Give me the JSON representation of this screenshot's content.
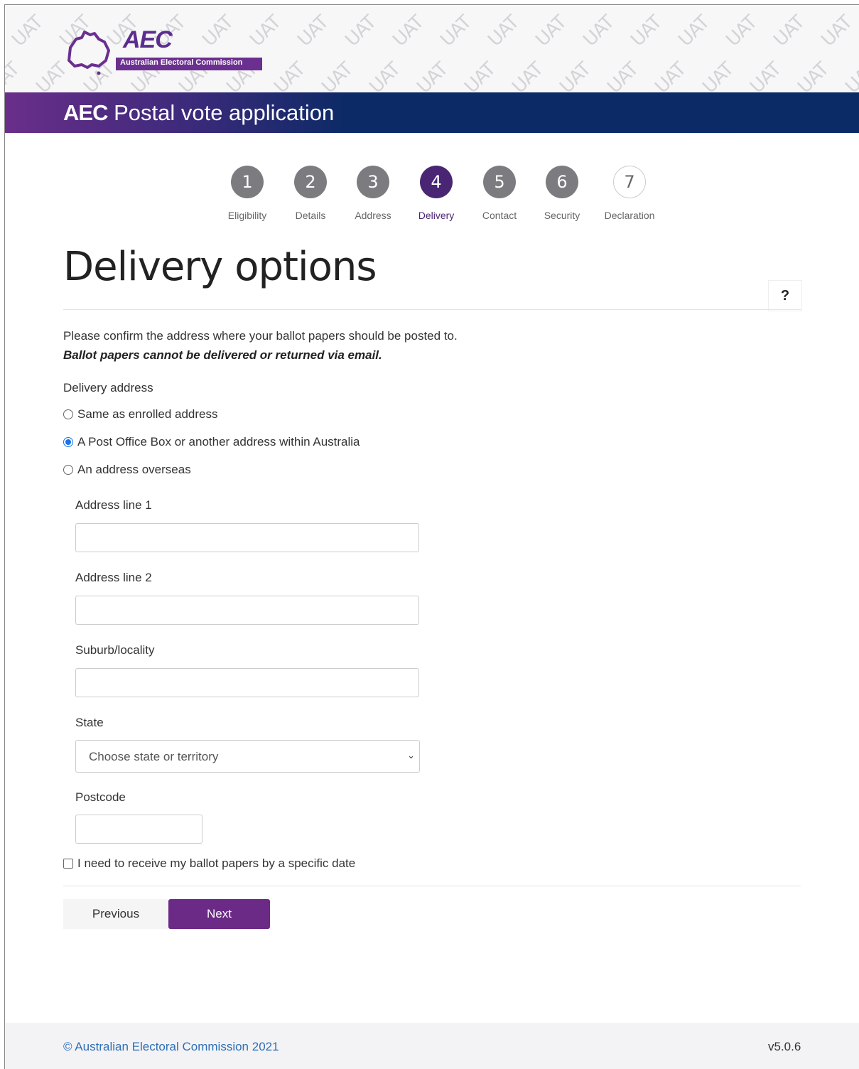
{
  "header": {
    "watermark": "UAT",
    "logo_text": "AEC",
    "logo_subtitle": "Australian Electoral Commission",
    "title_bold": "AEC",
    "title_rest": " Postal vote application"
  },
  "stepper": [
    {
      "num": "1",
      "label": "Eligibility",
      "state": "done"
    },
    {
      "num": "2",
      "label": "Details",
      "state": "done"
    },
    {
      "num": "3",
      "label": "Address",
      "state": "done"
    },
    {
      "num": "4",
      "label": "Delivery",
      "state": "current"
    },
    {
      "num": "5",
      "label": "Contact",
      "state": "todo"
    },
    {
      "num": "6",
      "label": "Security",
      "state": "todo"
    },
    {
      "num": "7",
      "label": "Declaration",
      "state": "future"
    }
  ],
  "page": {
    "heading": "Delivery options",
    "help_label": "?",
    "intro": "Please confirm the address where your ballot papers should be posted to.",
    "intro_bold": "Ballot papers cannot be delivered or returned via email."
  },
  "delivery": {
    "label": "Delivery address",
    "options": [
      {
        "label": "Same as enrolled address",
        "checked": false
      },
      {
        "label": "A Post Office Box or another address within Australia",
        "checked": true
      },
      {
        "label": "An address overseas",
        "checked": false
      }
    ]
  },
  "form": {
    "address1_label": "Address line 1",
    "address1_value": "",
    "address2_label": "Address line 2",
    "address2_value": "",
    "suburb_label": "Suburb/locality",
    "suburb_value": "",
    "state_label": "State",
    "state_value": "Choose state or territory",
    "postcode_label": "Postcode",
    "postcode_value": "",
    "specific_date_label": "I need to receive my ballot papers by a specific date"
  },
  "nav": {
    "previous": "Previous",
    "next": "Next"
  },
  "footer": {
    "copyright": "© Australian Electoral Commission 2021",
    "version": "v5.0.6"
  },
  "colors": {
    "brand_purple": "#6b2a86",
    "step_current": "#4a2573",
    "titlebar_navy": "#0b2b66",
    "link_blue": "#2f6fb5"
  }
}
